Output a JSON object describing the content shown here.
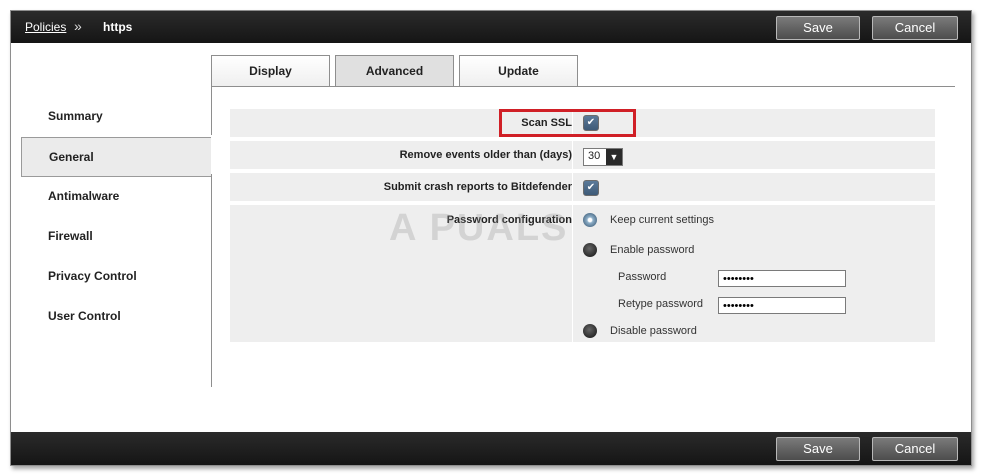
{
  "header": {
    "breadcrumb_link": "Policies",
    "breadcrumb_separator": "»",
    "breadcrumb_current": "https",
    "save_label": "Save",
    "cancel_label": "Cancel"
  },
  "footer": {
    "save_label": "Save",
    "cancel_label": "Cancel"
  },
  "nav": {
    "items": [
      {
        "label": "Summary"
      },
      {
        "label": "General"
      },
      {
        "label": "Antimalware"
      },
      {
        "label": "Firewall"
      },
      {
        "label": "Privacy Control"
      },
      {
        "label": "User Control"
      }
    ],
    "active_index": 1
  },
  "tabs": [
    {
      "label": "Display"
    },
    {
      "label": "Advanced"
    },
    {
      "label": "Update"
    }
  ],
  "active_tab": 1,
  "settings": {
    "scan_ssl": {
      "label": "Scan SSL",
      "checked": true
    },
    "remove_events": {
      "label": "Remove events older than (days)",
      "value": "30"
    },
    "crash_reports": {
      "label": "Submit crash reports to Bitdefender",
      "checked": true
    },
    "password_config": {
      "label": "Password configuration",
      "options": [
        {
          "label": "Keep current settings",
          "selected": true
        },
        {
          "label": "Enable password",
          "selected": false
        },
        {
          "label": "Disable password",
          "selected": false
        }
      ],
      "password_label": "Password",
      "password_value": "••••••••",
      "retype_label": "Retype password",
      "retype_value": "••••••••"
    }
  },
  "watermark": "A  PUALS",
  "colors": {
    "bar": "#1f1f1f",
    "highlight": "#d01f26",
    "row_bg": "#eeeeee",
    "checkbox": "#4a6986"
  },
  "icons": {
    "checkbox": "checkmark-icon",
    "select_arrow": "chevron-down-icon"
  }
}
